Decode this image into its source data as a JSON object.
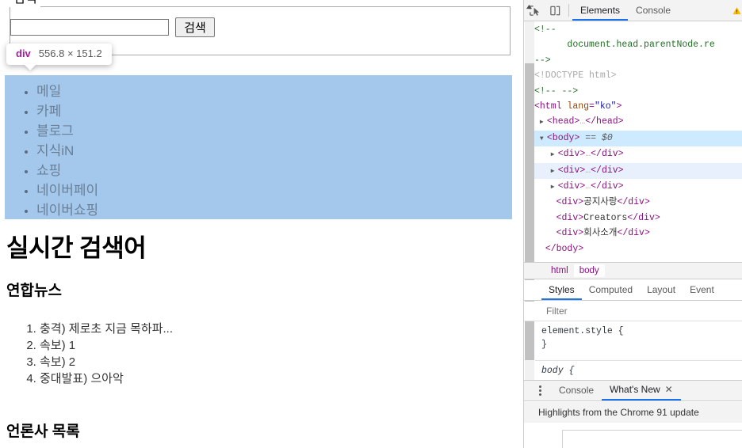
{
  "page": {
    "fieldset_legend": "검색",
    "search": {
      "value": "",
      "placeholder": "",
      "button_label": "검색"
    },
    "inspector_tooltip": {
      "tag": "div",
      "dimensions": "556.8 × 151.2"
    },
    "nav_list": [
      "메일",
      "카페",
      "블로그",
      "지식iN",
      "쇼핑",
      "네이버페이",
      "네이버쇼핑"
    ],
    "h1": "실시간 검색어",
    "h3_news": "연합뉴스",
    "news_items": [
      "충격) 제로초 지금 목하파...",
      "속보) 1",
      "속보) 2",
      "중대발표) 으아악"
    ],
    "h3_press": "언론사 목록",
    "colors": {
      "highlight": "#a3c8ec",
      "highlight_text": "#6a7f96",
      "tooltip_tag": "#a020a0"
    }
  },
  "devtools": {
    "toolbar": {
      "inspect_icon": "inspect-element-icon",
      "device_icon": "device-toolbar-icon",
      "tabs": [
        {
          "label": "Elements",
          "active": true
        },
        {
          "label": "Console",
          "active": false
        }
      ],
      "warning_icon": "warning-triangle-icon"
    },
    "dom_tree": [
      {
        "indent": 1,
        "kind": "comment-tail",
        "text": "<!--"
      },
      {
        "indent": 3,
        "kind": "comment",
        "text": "document.head.parentNode.re"
      },
      {
        "indent": 1,
        "kind": "comment",
        "text": "-->"
      },
      {
        "indent": 1,
        "kind": "doctype",
        "text": "<!DOCTYPE html>"
      },
      {
        "indent": 1,
        "kind": "comment",
        "text": "<!-- -->"
      },
      {
        "indent": 1,
        "kind": "open-attr",
        "tag": "html",
        "attr": "lang",
        "value": "\"ko\""
      },
      {
        "indent": 2,
        "kind": "collapsed",
        "tag": "head"
      },
      {
        "indent": 1,
        "kind": "selected-body",
        "tag": "body",
        "suffix": "== $0"
      },
      {
        "indent": 3,
        "kind": "collapsed-div",
        "tag": "div"
      },
      {
        "indent": 3,
        "kind": "collapsed-div-hover",
        "tag": "div"
      },
      {
        "indent": 3,
        "kind": "collapsed-div",
        "tag": "div"
      },
      {
        "indent": 3,
        "kind": "text-div",
        "tag": "div",
        "text": "공지사랑"
      },
      {
        "indent": 3,
        "kind": "text-div",
        "tag": "div",
        "text": "Creators"
      },
      {
        "indent": 3,
        "kind": "text-div",
        "tag": "div",
        "text": "회사소개"
      },
      {
        "indent": 2,
        "kind": "close",
        "tag": "body"
      },
      {
        "indent": 1,
        "kind": "close",
        "tag": "html"
      }
    ],
    "breadcrumb": [
      {
        "label": "html",
        "active": false
      },
      {
        "label": "body",
        "active": true
      }
    ],
    "styles_tabs": [
      {
        "label": "Styles",
        "active": true
      },
      {
        "label": "Computed",
        "active": false
      },
      {
        "label": "Layout",
        "active": false
      },
      {
        "label": "Event",
        "active": false
      }
    ],
    "filter_placeholder": "Filter",
    "css_rules": [
      {
        "selector": "element.style {",
        "close": "}"
      },
      {
        "selector": "body {",
        "close": ""
      }
    ],
    "drawer": {
      "menu_icon": "kebab-menu-icon",
      "tabs": [
        {
          "label": "Console",
          "active": false,
          "closable": false
        },
        {
          "label": "What's New",
          "active": true,
          "closable": true,
          "close_glyph": "✕"
        }
      ],
      "subtitle": "Highlights from the Chrome 91 update"
    },
    "scrollbar": {
      "up_arrow_icon": "scroll-up-arrow-icon"
    }
  }
}
